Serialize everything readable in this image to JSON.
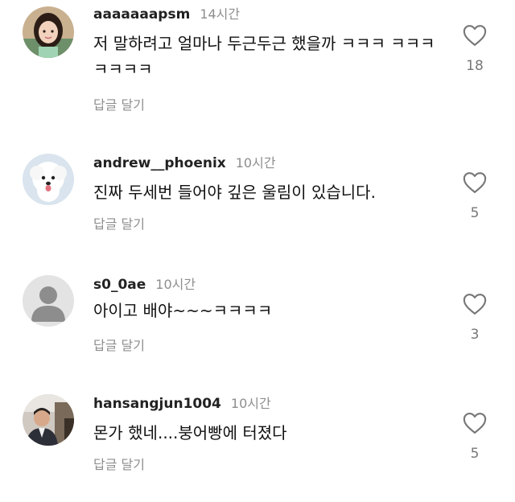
{
  "comments": [
    {
      "username": "aaaaaaapsm",
      "timestamp": "14시간",
      "text": "저 말하려고 얼마나 두근두근 했을까 ㅋㅋㅋ ㅋㅋㅋㅋㅋㅋㅋ",
      "reply_label": "답글 달기",
      "likes": "18",
      "avatar": "avatar-girl-photo"
    },
    {
      "username": "andrew__phoenix",
      "timestamp": "10시간",
      "text": "진짜 두세번 들어야 깊은 울림이 있습니다.",
      "reply_label": "답글 달기",
      "likes": "5",
      "avatar": "avatar-white-dog-photo"
    },
    {
      "username": "s0_0ae",
      "timestamp": "10시간",
      "text": "아이고 배야~~~ㅋㅋㅋㅋ",
      "reply_label": "답글 달기",
      "likes": "3",
      "avatar": "avatar-default-user"
    },
    {
      "username": "hansangjun1004",
      "timestamp": "10시간",
      "text": "몬가 했네....붕어빵에 터졌다",
      "reply_label": "답글 달기",
      "likes": "5",
      "avatar": "avatar-man-photo"
    }
  ],
  "colors": {
    "secondary_text": "#8e8e8e",
    "primary_text": "#111111",
    "heart_outline": "#777777",
    "background": "#ffffff"
  },
  "icons": {
    "like": "heart-outline-icon"
  }
}
